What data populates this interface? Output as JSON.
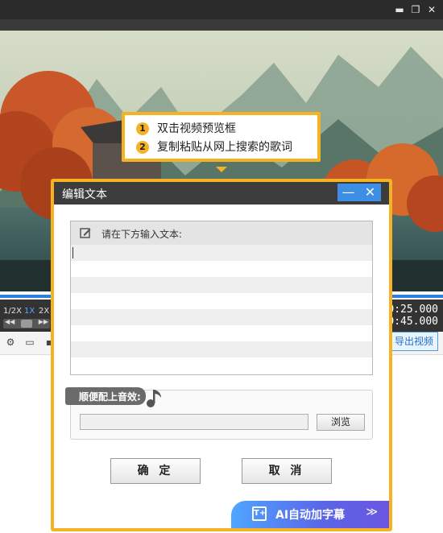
{
  "window": {
    "minimize_glyph": "▬",
    "restore_glyph": "❐",
    "close_glyph": "✕"
  },
  "callout": {
    "steps": [
      {
        "num": "1",
        "text": "双击视频预览框"
      },
      {
        "num": "2",
        "text": "复制粘贴从网上搜索的歌词"
      }
    ],
    "accent_color": "#f5b324"
  },
  "player": {
    "speeds": [
      "1/2X",
      "1X",
      "2X"
    ],
    "active_speed": "1X",
    "time_current": "0:25.000",
    "time_total": "0:45.000",
    "export_label": "导出视频",
    "progress_color": "#2f7fe0"
  },
  "dialog": {
    "title": "编辑文本",
    "minimize_glyph": "—",
    "close_glyph": "✕",
    "text_prompt": "请在下方输入文本:",
    "text_value": "",
    "sfx_label": "顺便配上音效:",
    "sfx_path": "",
    "browse_label": "浏览",
    "ok_label": "确 定",
    "cancel_label": "取 消",
    "ai_label": "AI自动加字幕",
    "ai_arrow": "≫",
    "ai_icon": "T+"
  }
}
